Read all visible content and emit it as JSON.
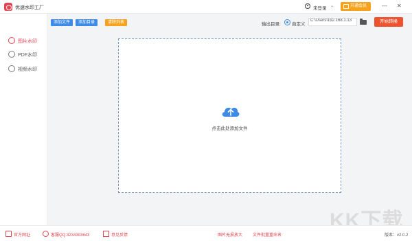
{
  "app": {
    "title": "优速水印工厂"
  },
  "header": {
    "login_label": "未登录",
    "vip_label": "开通会员",
    "window_controls": [
      "—",
      "✕"
    ]
  },
  "sidebar": {
    "items": [
      {
        "label": "图片水印",
        "active": true,
        "icon": "image-watermark-icon"
      },
      {
        "label": "PDF水印",
        "active": false,
        "icon": "pdf-icon"
      },
      {
        "label": "视频水印",
        "active": false,
        "icon": "video-icon"
      }
    ]
  },
  "toolbar": {
    "add_file": "添加文件",
    "add_folder": "添加目录",
    "clear_list": "清除列表",
    "output_label": "输出目录:",
    "custom_option": "自定义",
    "path_value": "C:\\Users\\192.168.1.13",
    "start_button": "开始转换"
  },
  "dropzone": {
    "text": "点击此处添加文件"
  },
  "footer": {
    "official_site": "官方网址",
    "support_qq": "客服QQ:3234303643",
    "feedback": "意见反馈",
    "link1": "图片无损放大",
    "link2": "文件批量重命名",
    "version": "版本：v2.0.2"
  },
  "watermark_text": "KK下载",
  "colors": {
    "accent": "#e3444f",
    "blue": "#3d8be6",
    "orange": "#f7a21c",
    "start": "#f0522f"
  }
}
